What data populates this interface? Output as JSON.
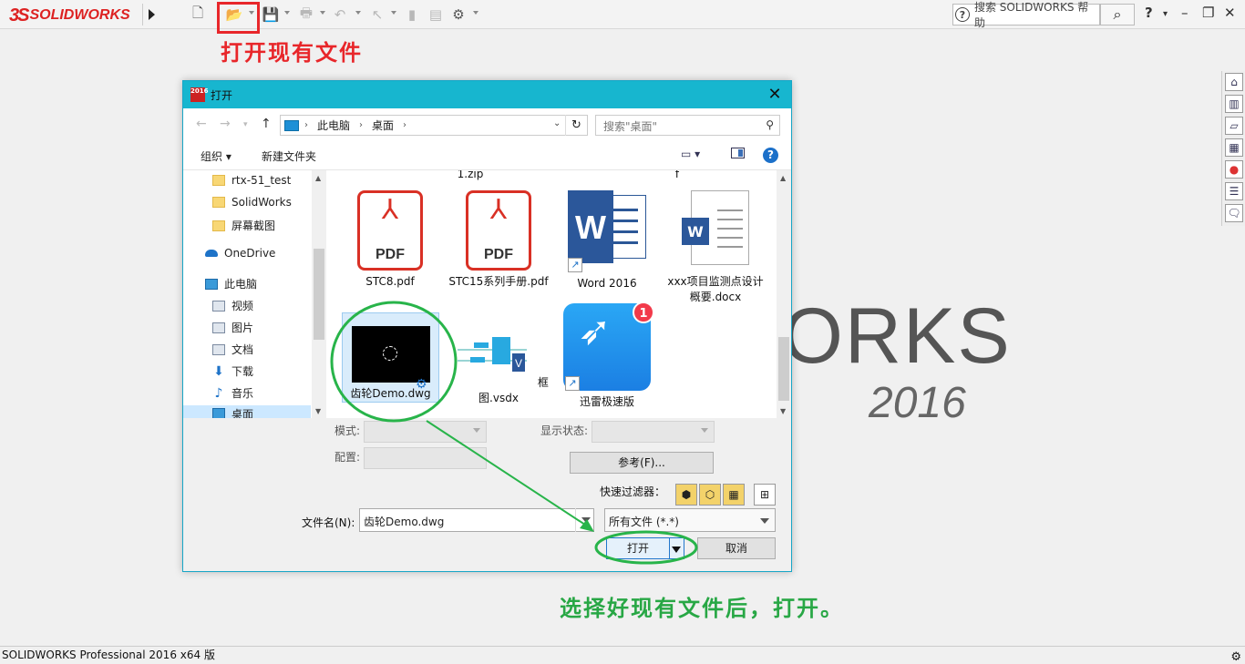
{
  "app": {
    "logo_text": "SOLIDWORKS",
    "brand_works": "ORKS",
    "brand_year": "2016",
    "search_help_placeholder": "搜索 SOLIDWORKS 帮助",
    "status_text": "SOLIDWORKS Professional 2016 x64 版"
  },
  "annotations": {
    "open_existing": "打开现有文件",
    "select_then_open": "选择好现有文件后，打开。"
  },
  "dialog": {
    "title": "打开",
    "title_icon_text": "2016",
    "address": {
      "pc": "此电脑",
      "folder": "桌面"
    },
    "search_placeholder": "搜索\"桌面\"",
    "organize": "组织 ▾",
    "new_folder": "新建文件夹",
    "nav_items": [
      {
        "label": "rtx-51_test",
        "icon": "folder-icon"
      },
      {
        "label": "SolidWorks",
        "icon": "folder-icon"
      },
      {
        "label": "屏幕截图",
        "icon": "folder-icon"
      },
      {
        "label": "OneDrive",
        "icon": "cloud-icon"
      },
      {
        "label": "此电脑",
        "icon": "pc-icon"
      },
      {
        "label": "视频",
        "icon": "video-icon"
      },
      {
        "label": "图片",
        "icon": "picture-icon"
      },
      {
        "label": "文档",
        "icon": "document-icon"
      },
      {
        "label": "下载",
        "icon": "download-icon"
      },
      {
        "label": "音乐",
        "icon": "music-icon"
      },
      {
        "label": "桌面",
        "icon": "desktop-icon"
      }
    ],
    "files_partial": [
      "1.zip",
      "f"
    ],
    "files": [
      {
        "name": "STC8.pdf",
        "type": "pdf"
      },
      {
        "name": "STC15系列手册.pdf",
        "type": "pdf"
      },
      {
        "name": "Word 2016",
        "type": "word-shortcut"
      },
      {
        "name": "xxx项目监测点设计概要.docx",
        "type": "docx"
      },
      {
        "name": "齿轮Demo.dwg",
        "type": "dwg"
      },
      {
        "name": "框图.vsdx",
        "type": "vsdx"
      },
      {
        "name": "迅雷极速版",
        "type": "xunlei-shortcut",
        "badge": "1"
      }
    ],
    "pdf_label": "PDF",
    "pdf_symbol": "⅄",
    "word_letter": "W",
    "mode_label": "模式:",
    "config_label": "配置:",
    "display_state_label": "显示状态:",
    "reference_button": "参考(F)...",
    "quick_filter_label": "快速过滤器：",
    "filename_label": "文件名(N):",
    "filename_value": "齿轮Demo.dwg",
    "filetype_value": "所有文件 (*.*)",
    "open_button": "打开",
    "cancel_button": "取消"
  },
  "colors": {
    "title_bar": "#17b6cf",
    "annotation_red": "#e8262a",
    "annotation_green": "#28a745"
  }
}
